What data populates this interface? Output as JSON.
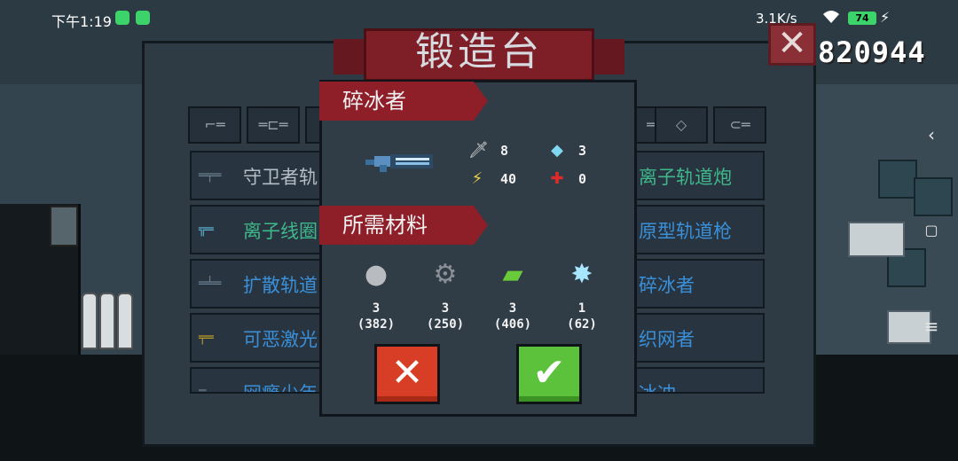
{
  "status_bar": {
    "time": "下午1:19",
    "network_speed": "3.1K/s",
    "battery": "74"
  },
  "hud": {
    "coins": "820944"
  },
  "forge": {
    "title": "锻造台",
    "rows_left": [
      {
        "label": "守卫者轨",
        "color": "#b4bcc4"
      },
      {
        "label": "离子线圈",
        "color": "#3fb78a"
      },
      {
        "label": "扩散轨道",
        "color": "#3a8fd8"
      },
      {
        "label": "可恶激光",
        "color": "#3a8fd8"
      },
      {
        "label": "网瘾少年",
        "color": "#3a8fd8"
      }
    ],
    "rows_right": [
      {
        "label": "离子轨道炮",
        "color": "#3fb78a"
      },
      {
        "label": "原型轨道枪",
        "color": "#3a8fd8"
      },
      {
        "label": "碎冰者",
        "color": "#3a8fd8"
      },
      {
        "label": "织网者",
        "color": "#3a8fd8"
      },
      {
        "label": "冰冲",
        "color": "#3a8fd8"
      }
    ]
  },
  "dialog": {
    "weapon_name": "碎冰者",
    "stats": {
      "damage": "8",
      "energy": "3",
      "crit": "40",
      "accuracy": "0"
    },
    "materials_title": "所需材料",
    "materials": [
      {
        "icon": "ore-icon",
        "required": "3",
        "owned": "(382)"
      },
      {
        "icon": "gear-icon",
        "required": "3",
        "owned": "(250)"
      },
      {
        "icon": "battery-part-icon",
        "required": "3",
        "owned": "(406)"
      },
      {
        "icon": "ice-crystal-icon",
        "required": "1",
        "owned": "(62)"
      }
    ]
  },
  "colors": {
    "cancel": "#d83e25",
    "confirm": "#5cc23b",
    "banner": "#8e1e28"
  }
}
